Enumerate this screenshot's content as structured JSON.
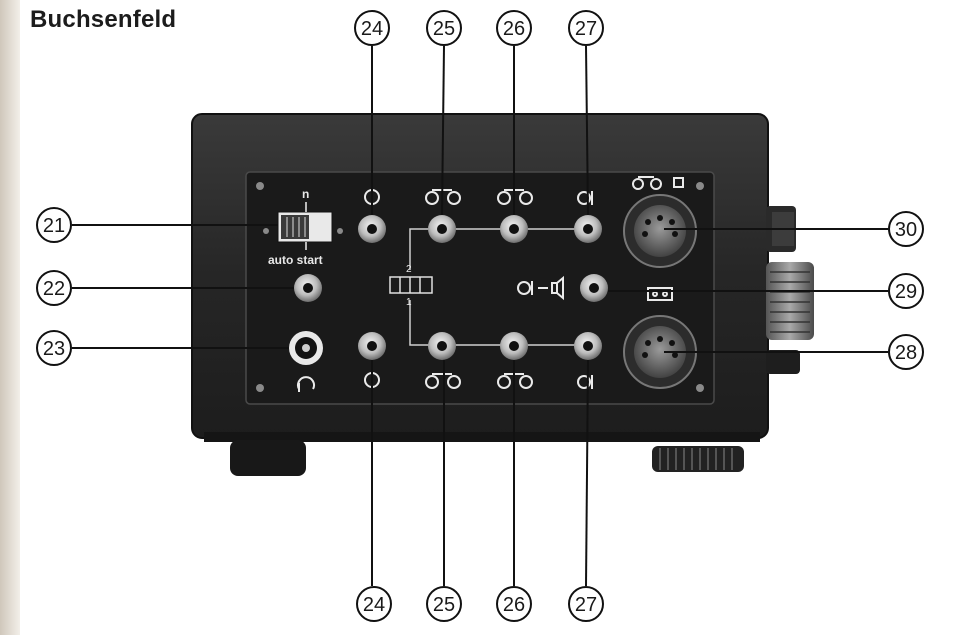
{
  "page": {
    "title": "Buchsenfeld",
    "device_labels": {
      "switch_upper_mark": "n",
      "switch_lower_label": "auto start",
      "bus_label_upper": "2",
      "bus_label_lower": "1"
    },
    "callouts": {
      "top_row": [
        "24",
        "25",
        "26",
        "27"
      ],
      "bottom_row": [
        "24",
        "25",
        "26",
        "27"
      ],
      "left_column": [
        "21",
        "22",
        "23"
      ],
      "right_column": [
        "30",
        "29",
        "28"
      ]
    }
  },
  "icons": [
    "record-input-symbol-icon",
    "two-reel-symbol-icon",
    "playback-output-symbol-icon",
    "headphone-symbol-icon",
    "speaker-output-symbol-icon",
    "tape-cassette-symbol-icon"
  ],
  "colors": {
    "device_body": "#2b2b2b",
    "panel": "#1b1b1b",
    "socket_ring": "#c9c9c9",
    "callout_line": "#111111"
  }
}
